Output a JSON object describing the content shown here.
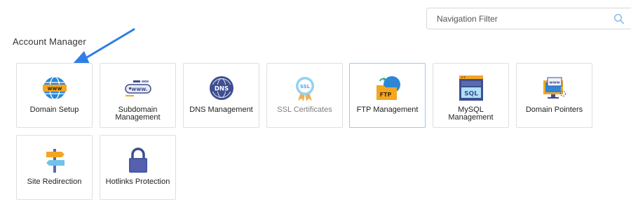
{
  "search": {
    "placeholder": "Navigation Filter",
    "icon": "search-icon"
  },
  "section": {
    "title": "Account Manager"
  },
  "colors": {
    "accent": "#2f80ed",
    "arrow": "#2f7ee8",
    "active_border": "#9fc7ec"
  },
  "tiles": [
    {
      "label": "Domain Setup",
      "icon": "globe-www-icon"
    },
    {
      "label": "Subdomain Management",
      "icon": "subdomain-www-icon"
    },
    {
      "label": "DNS Management",
      "icon": "dns-globe-icon"
    },
    {
      "label": "SSL Certificates",
      "icon": "ssl-badge-icon"
    },
    {
      "label": "FTP Management",
      "icon": "ftp-folder-icon"
    },
    {
      "label": "MySQL Management",
      "icon": "sql-database-icon"
    },
    {
      "label": "Domain Pointers",
      "icon": "monitor-pointer-icon"
    },
    {
      "label": "Site Redirection",
      "icon": "signpost-icon"
    },
    {
      "label": "Hotlinks Protection",
      "icon": "lock-icon"
    }
  ]
}
